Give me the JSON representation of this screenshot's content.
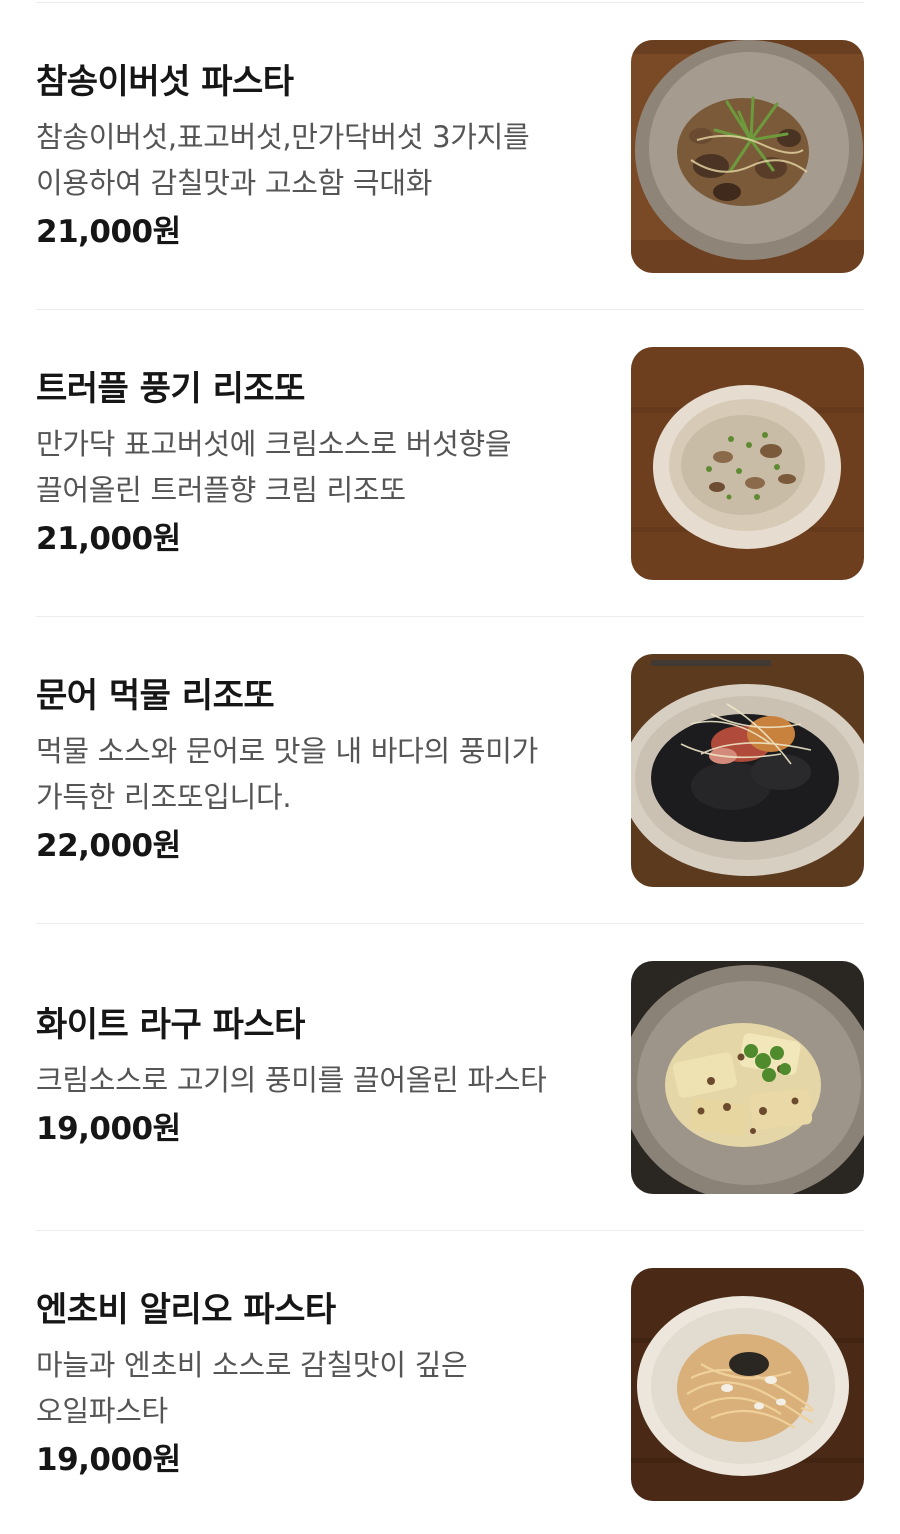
{
  "menu": {
    "items": [
      {
        "name": "참송이버섯 파스타",
        "description": "참송이버섯,표고버섯,만가닥버섯 3가지를 이용하여 감칠맛과 고소함 극대화",
        "price": "21,000원",
        "photo_icon": "mushroom-pasta-photo"
      },
      {
        "name": "트러플 풍기 리조또",
        "description": "만가닥 표고버섯에 크림소스로 버섯향을 끌어올린 트러플향 크림 리조또",
        "price": "21,000원",
        "photo_icon": "truffle-risotto-photo"
      },
      {
        "name": "문어 먹물 리조또",
        "description": "먹물 소스와 문어로 맛을 내 바다의 풍미가 가득한 리조또입니다.",
        "price": "22,000원",
        "photo_icon": "squid-ink-risotto-photo"
      },
      {
        "name": "화이트 라구 파스타",
        "description": "크림소스로 고기의 풍미를 끌어올린 파스타",
        "price": "19,000원",
        "photo_icon": "white-ragu-pasta-photo"
      },
      {
        "name": "엔초비 알리오 파스타",
        "description": "마늘과 엔초비 소스로 감칠맛이 깊은 오일파스타",
        "price": "19,000원",
        "photo_icon": "anchovy-aglio-pasta-photo"
      }
    ]
  },
  "colors": {
    "name_text": "#161616",
    "description_text": "#555555",
    "divider": "#ececec",
    "wood_table": "#6b4424"
  }
}
